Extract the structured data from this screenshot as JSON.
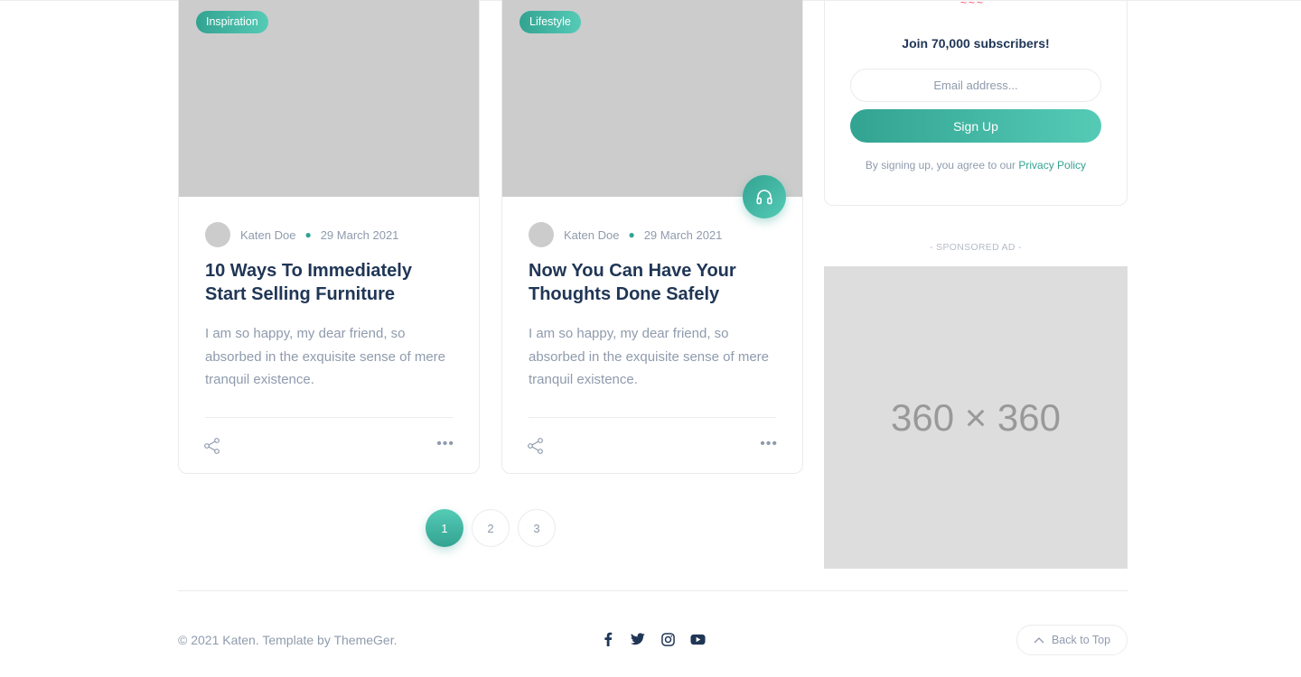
{
  "posts": [
    {
      "category": "Inspiration",
      "author": "Katen Doe",
      "date": "29 March 2021",
      "title": "10 Ways To Immediately Start Selling Furniture",
      "excerpt": "I am so happy, my dear friend, so absorbed in the exquisite sense of mere tranquil existence."
    },
    {
      "category": "Lifestyle",
      "author": "Katen Doe",
      "date": "29 March 2021",
      "title": "Now You Can Have Your Thoughts Done Safely",
      "excerpt": "I am so happy, my dear friend, so absorbed in the exquisite sense of mere tranquil existence.",
      "audio_icon": "headphones-icon"
    }
  ],
  "pagination": {
    "pages": [
      "1",
      "2",
      "3"
    ],
    "active": "1"
  },
  "newsletter": {
    "title": "Join 70,000 subscribers!",
    "email_placeholder": "Email address...",
    "button": "Sign Up",
    "note": "By signing up, you agree to our",
    "policy_link": "Privacy Policy"
  },
  "sponsored": {
    "label": "- SPONSORED AD -",
    "ad_text": "360 × 360"
  },
  "footer": {
    "copyright": "© 2021 Katen. Template by ThemeGer.",
    "socials": [
      "facebook-icon",
      "twitter-icon",
      "instagram-icon",
      "youtube-icon"
    ],
    "back_to_top": "Back to Top"
  },
  "colors": {
    "accent": "#32a391",
    "accent_light": "#55cbb6",
    "heading": "#203656",
    "muted": "#8f9bad"
  }
}
